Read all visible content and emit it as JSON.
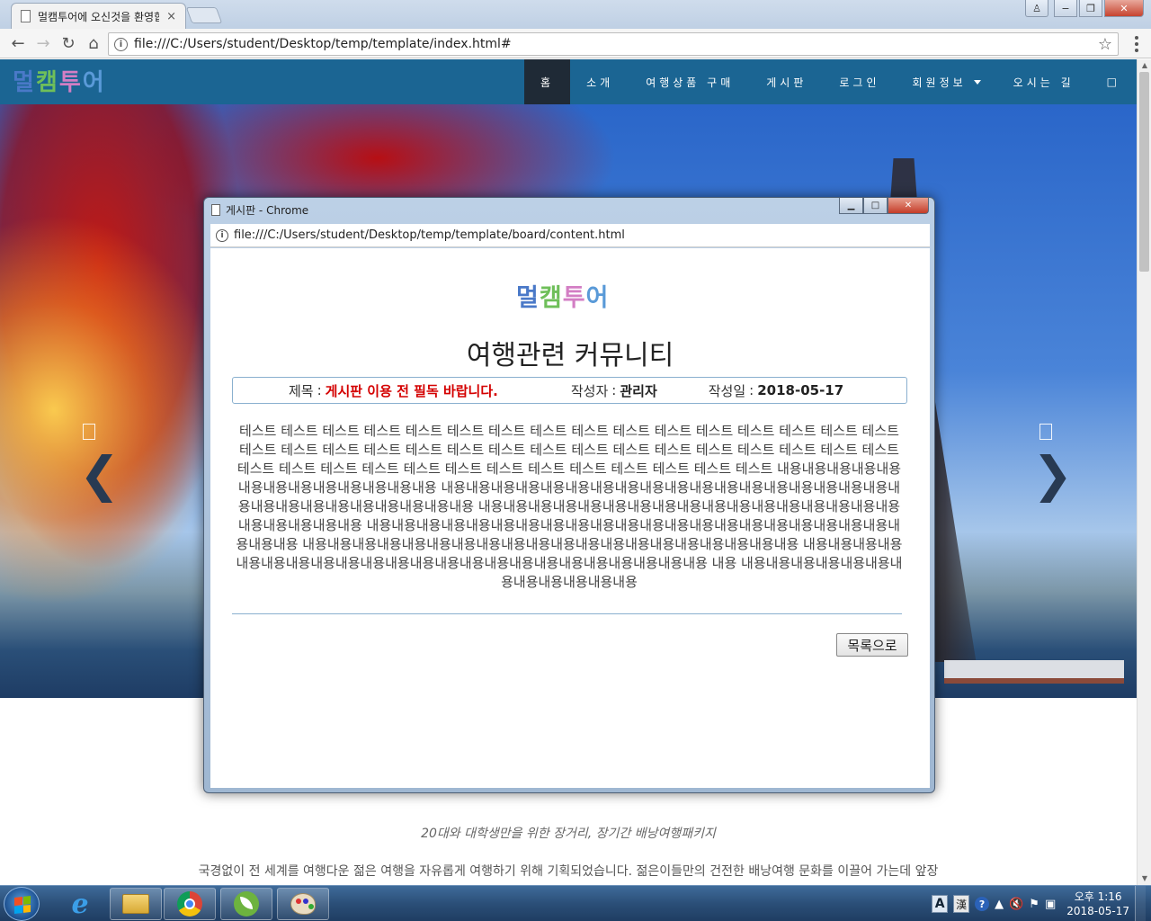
{
  "browser": {
    "tab_title": "멀캠투어에 오신것을 환영합니다",
    "tab_close": "×",
    "url": "file:///C:/Users/student/Desktop/temp/template/index.html#",
    "back": "←",
    "forward": "→",
    "reload": "↻",
    "home": "⌂",
    "star": "☆",
    "window_controls": {
      "user": "♙",
      "minimize": "−",
      "maximize": "❐",
      "close": "✕"
    }
  },
  "site": {
    "brand": [
      "멀",
      "캠",
      "투",
      "어"
    ],
    "brand_colors": [
      "#4a79c8",
      "#6fbf5a",
      "#d37ec4",
      "#5a9ad8"
    ],
    "nav": [
      {
        "label": "홈",
        "active": true
      },
      {
        "label": "소개"
      },
      {
        "label": "여행상품 구매"
      },
      {
        "label": "게시판"
      },
      {
        "label": "로그인"
      },
      {
        "label": "회원정보",
        "dropdown": true
      },
      {
        "label": "오시는 길"
      },
      {
        "label": "□"
      }
    ],
    "carousel_prev": "❯",
    "carousel_next": "❯",
    "tagline": "20대와 대학생만을 위한 장거리, 장기간 배낭여행패키지",
    "description": "국경없이 전 세계를 여행다운 젊은 여행을 자유롭게 여행하기 위해 기획되었습니다. 젊은이들만의 건전한 배낭여행 문화를 이끌어 가는데 앞장"
  },
  "popup": {
    "window_title": "게시판 - Chrome",
    "url": "file:///C:/Users/student/Desktop/temp/template/board/content.html",
    "controls": {
      "minimize": "▁",
      "maximize": "□",
      "close": "✕"
    },
    "logo": [
      "멀",
      "캠",
      "투",
      "어"
    ],
    "logo_colors": [
      "#4a79c8",
      "#6fbf5a",
      "#d37ec4",
      "#5a9ad8"
    ],
    "heading": "여행관련 커뮤니티",
    "post": {
      "title_label": "제목",
      "title_value": "게시판 이용 전 필독 바랍니다.",
      "writer_label": "작성자",
      "writer_value": "관리자",
      "date_label": "작성일",
      "date_value": "2018-05-17",
      "body": "테스트 테스트 테스트 테스트 테스트 테스트 테스트 테스트 테스트 테스트 테스트 테스트 테스트 테스트 테스트 테스트 테스트 테스트 테스트 테스트 테스트 테스트 테스트 테스트 테스트 테스트 테스트 테스트 테스트 테스트 테스트 테스트 테스트 테스트 테스트 테스트 테스트 테스트 테스트 테스트 테스트 테스트 테스트 테스트 테스트 내용내용내용내용내용내용내용내용내용내용내용내용내용 내용내용내용내용내용내용내용내용내용내용내용내용내용내용내용내용내용내용내용내용내용내용내용내용내용내용내용내용 내용내용내용내용내용내용내용내용내용내용내용내용내용내용내용내용내용내용내용내용내용내용 내용내용내용내용내용내용내용내용내용내용내용내용내용내용내용내용내용내용내용내용내용내용내용내용 내용내용내용내용내용내용내용내용내용내용내용내용내용내용내용내용내용내용내용내용 내용내용내용내용내용내용내용내용내용내용내용내용내용내용내용내용내용내용내용내용내용내용내용 내용 내용내용내용내용내용내용내용내용내용내용내용내용",
      "list_button": "목록으로"
    }
  },
  "taskbar": {
    "ie": "e",
    "tray": {
      "ime_lang": "A",
      "ime_mode": "漢",
      "help": "?",
      "arrow": "▲",
      "volume": "🔇",
      "flag": "⚑",
      "network": "▣"
    },
    "clock_time": "오후 1:16",
    "clock_date": "2018-05-17"
  }
}
